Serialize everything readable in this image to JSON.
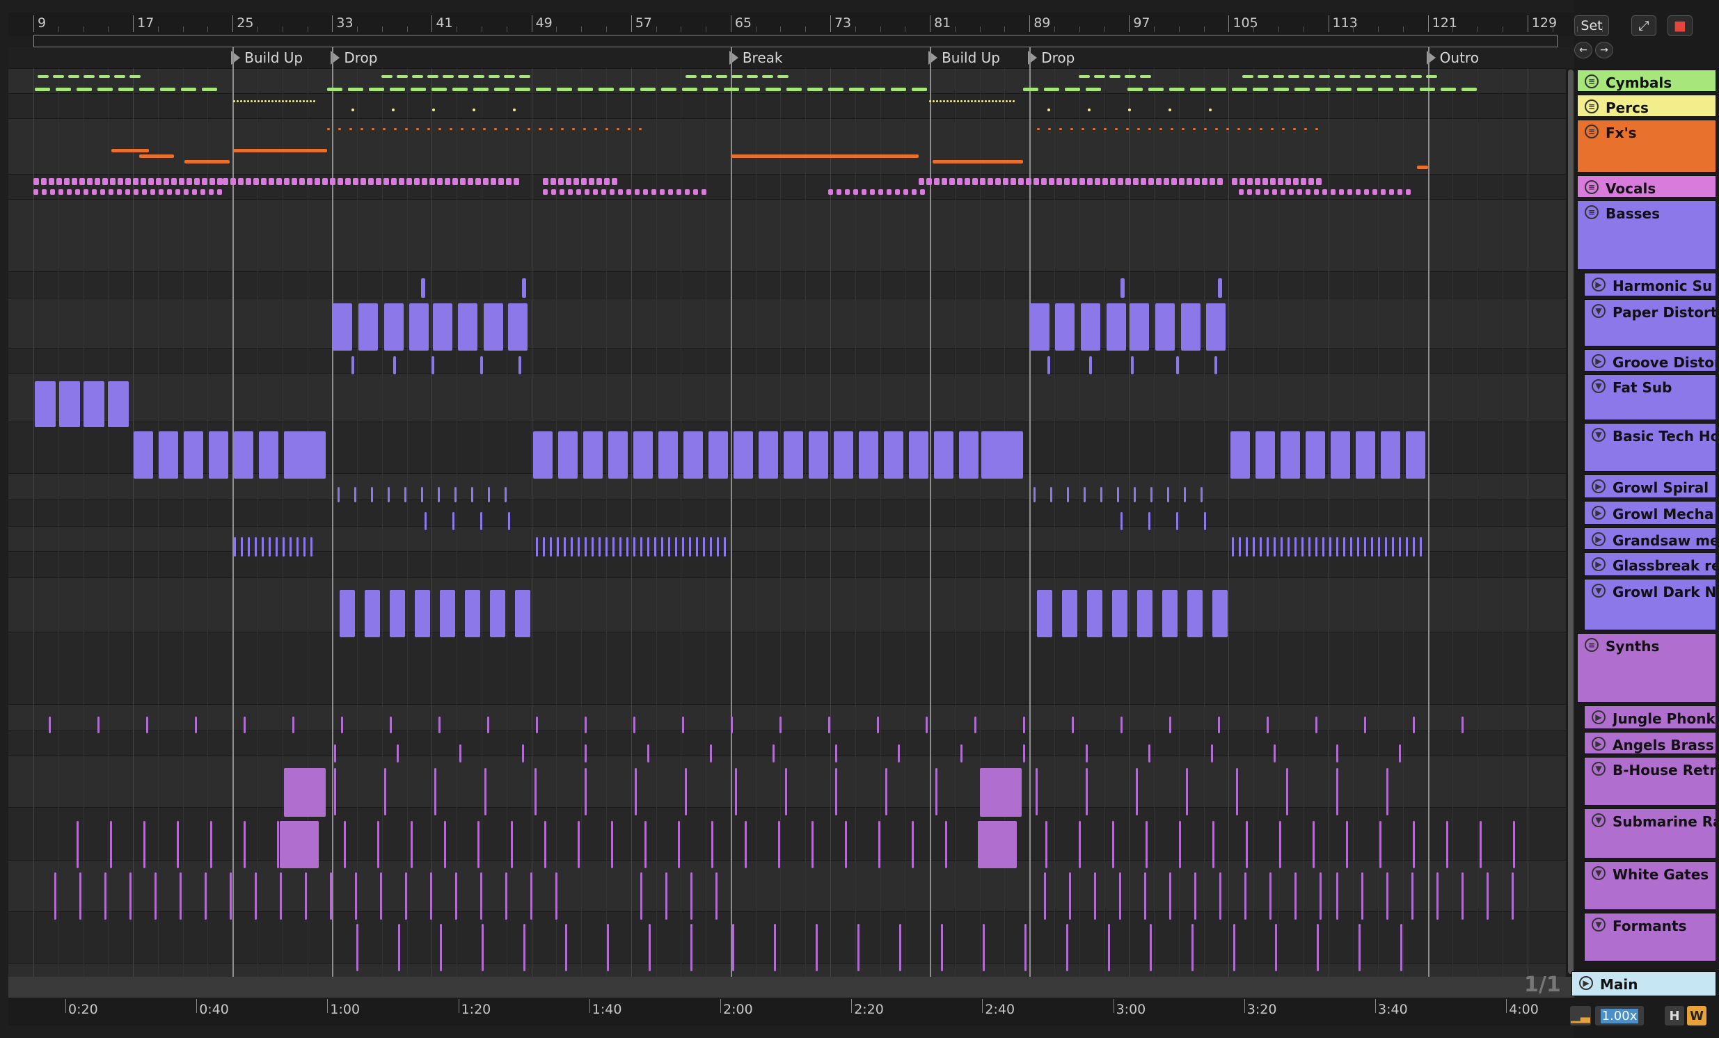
{
  "set_button_label": "Set",
  "page_indicator": "1/1",
  "zoom_value": "1.00x",
  "h_button_label": "H",
  "w_button_label": "W",
  "bar_ticks": [
    "9",
    "17",
    "25",
    "33",
    "41",
    "49",
    "57",
    "65",
    "73",
    "81",
    "89",
    "97",
    "105",
    "113",
    "121",
    "129"
  ],
  "time_ticks": [
    "0:20",
    "0:40",
    "1:00",
    "1:20",
    "1:40",
    "2:00",
    "2:20",
    "2:40",
    "3:00",
    "3:20",
    "3:40",
    "4:00"
  ],
  "locators": [
    {
      "label": "Build Up",
      "bar": 25
    },
    {
      "label": "Drop",
      "bar": 33
    },
    {
      "label": "Break",
      "bar": 65
    },
    {
      "label": "Build Up",
      "bar": 81
    },
    {
      "label": "Drop",
      "bar": 89
    },
    {
      "label": "Outro",
      "bar": 121
    }
  ],
  "colors": {
    "cymbals": "#a6e67a",
    "percs": "#f2ee8c",
    "fx": "#e8722d",
    "vocals": "#d87bdc",
    "basses": "#8c78e8",
    "synths": "#b06fce",
    "main": "#c6e6f4"
  },
  "tracks": [
    {
      "name": "Cymbals",
      "icon": "group-icon",
      "color": "#a6e67a",
      "group": true
    },
    {
      "name": "Percs",
      "icon": "group-icon",
      "color": "#f2ee8c",
      "group": true
    },
    {
      "name": "Fx's",
      "icon": "group-icon",
      "color": "#e8722d",
      "group": true
    },
    {
      "name": "Vocals",
      "icon": "group-icon",
      "color": "#d87bdc",
      "group": true
    },
    {
      "name": "Basses",
      "icon": "group-icon",
      "color": "#8c78e8",
      "group": true
    },
    {
      "name": "Harmonic Su",
      "icon": "play-icon",
      "color": "#8c78e8",
      "group": false
    },
    {
      "name": "Paper Distort",
      "icon": "chevron-down-icon",
      "color": "#8c78e8",
      "group": false
    },
    {
      "name": "Groove Distor",
      "icon": "play-icon",
      "color": "#8c78e8",
      "group": false
    },
    {
      "name": "Fat Sub",
      "icon": "chevron-down-icon",
      "color": "#8c78e8",
      "group": false
    },
    {
      "name": "Basic Tech Ho",
      "icon": "chevron-down-icon",
      "color": "#8c78e8",
      "group": false
    },
    {
      "name": "Growl Spiral",
      "icon": "play-icon",
      "color": "#8c78e8",
      "group": false
    },
    {
      "name": "Growl Mecha",
      "icon": "play-icon",
      "color": "#8c78e8",
      "group": false
    },
    {
      "name": "Grandsaw me",
      "icon": "play-icon",
      "color": "#8c78e8",
      "group": false
    },
    {
      "name": "Glassbreak re",
      "icon": "play-icon",
      "color": "#8c78e8",
      "group": false
    },
    {
      "name": "Growl Dark Ni",
      "icon": "chevron-down-icon",
      "color": "#8c78e8",
      "group": false
    },
    {
      "name": "Synths",
      "icon": "group-icon",
      "color": "#b06fce",
      "group": true
    },
    {
      "name": "Jungle Phonk",
      "icon": "play-icon",
      "color": "#b06fce",
      "group": false
    },
    {
      "name": "Angels Brass",
      "icon": "play-icon",
      "color": "#b06fce",
      "group": false
    },
    {
      "name": "B-House Retr",
      "icon": "chevron-down-icon",
      "color": "#b06fce",
      "group": false
    },
    {
      "name": "Submarine Ra",
      "icon": "chevron-down-icon",
      "color": "#b06fce",
      "group": false
    },
    {
      "name": "White Gates",
      "icon": "chevron-down-icon",
      "color": "#b06fce",
      "group": false
    },
    {
      "name": "Formants",
      "icon": "chevron-down-icon",
      "color": "#b06fce",
      "group": false
    },
    {
      "name": "Main",
      "icon": "play-icon",
      "color": "#c6e6f4",
      "group": false
    }
  ]
}
